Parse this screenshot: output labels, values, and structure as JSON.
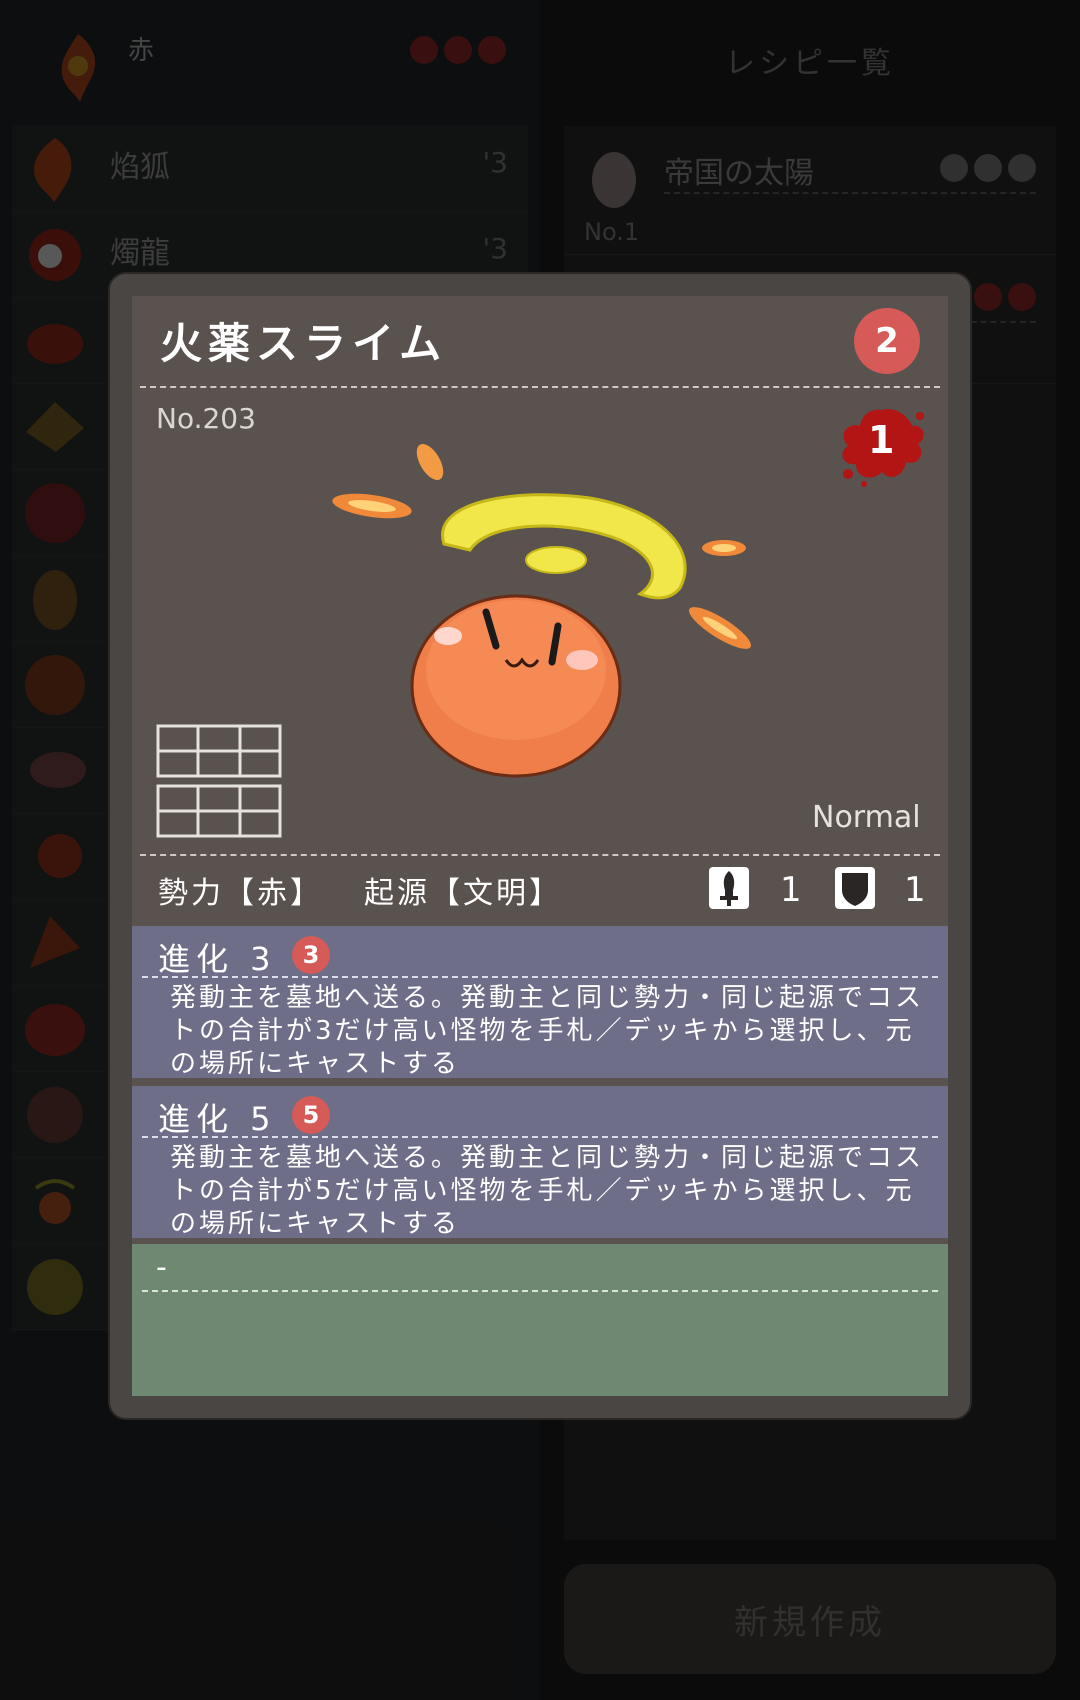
{
  "background": {
    "left_header": {
      "title": "赤"
    },
    "monsters": [
      {
        "name": "焰狐",
        "cost": "'3"
      },
      {
        "name": "燭龍",
        "cost": "'3"
      },
      {
        "name": "",
        "cost": ""
      },
      {
        "name": "",
        "cost": ""
      },
      {
        "name": "",
        "cost": ""
      },
      {
        "name": "",
        "cost": ""
      },
      {
        "name": "",
        "cost": ""
      },
      {
        "name": "",
        "cost": ""
      },
      {
        "name": "",
        "cost": ""
      },
      {
        "name": "",
        "cost": ""
      },
      {
        "name": "",
        "cost": ""
      },
      {
        "name": "",
        "cost": ""
      },
      {
        "name": "",
        "cost": ""
      },
      {
        "name": "",
        "cost": ""
      }
    ],
    "recipe_title": "レシピ一覧",
    "recipes": [
      {
        "name": "帝国の太陽",
        "no": "No.1"
      }
    ],
    "new_button": "新規作成"
  },
  "card": {
    "name": "火薬スライム",
    "cost": "2",
    "number": "No.203",
    "blood_value": "1",
    "rarity": "Normal",
    "faction_text": "勢力【赤】",
    "origin_text": "起源【文明】",
    "attack": "1",
    "defense": "1",
    "abilities": [
      {
        "title": "進化 3",
        "badge": "3",
        "text": "発動主を墓地へ送る。発動主と同じ勢力・同じ起源でコストの合計が3だけ高い怪物を手札／デッキから選択し、元の場所にキャストする"
      },
      {
        "title": "進化 5",
        "badge": "5",
        "text": "発動主を墓地へ送る。発動主と同じ勢力・同じ起源でコストの合計が5だけ高い怪物を手札／デッキから選択し、元の場所にキャストする"
      }
    ],
    "flavor": "-"
  },
  "colors": {
    "cost_badge": "#d65a57",
    "ability_panel": "#6f6e88",
    "flavor_panel": "#6f8872",
    "card_body": "#5a524f"
  },
  "icons": {
    "attack": "sword-icon",
    "defense": "shield-icon",
    "grid": "grid-icon",
    "blood": "blood-splatter-icon"
  }
}
